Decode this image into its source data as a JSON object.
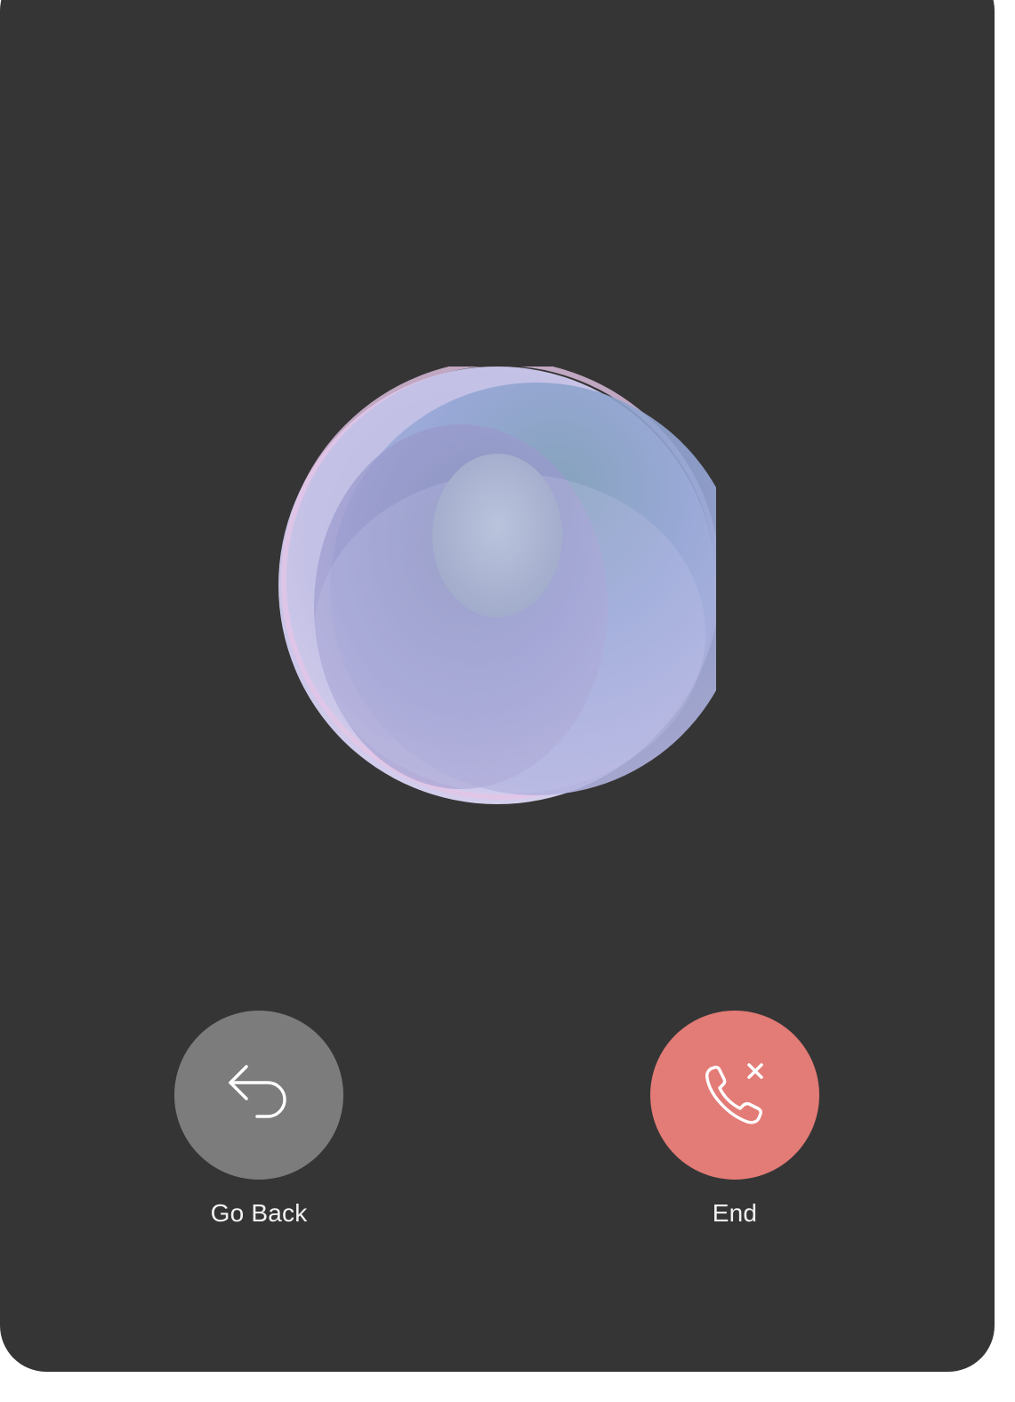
{
  "controls": {
    "go_back": {
      "label": "Go Back",
      "icon": "back-arrow-icon",
      "color": "#7c7c7c"
    },
    "end": {
      "label": "End",
      "icon": "phone-end-icon",
      "color": "#e37b76"
    }
  },
  "colors": {
    "card_background": "#353535",
    "label_text": "#f2f2f2"
  }
}
